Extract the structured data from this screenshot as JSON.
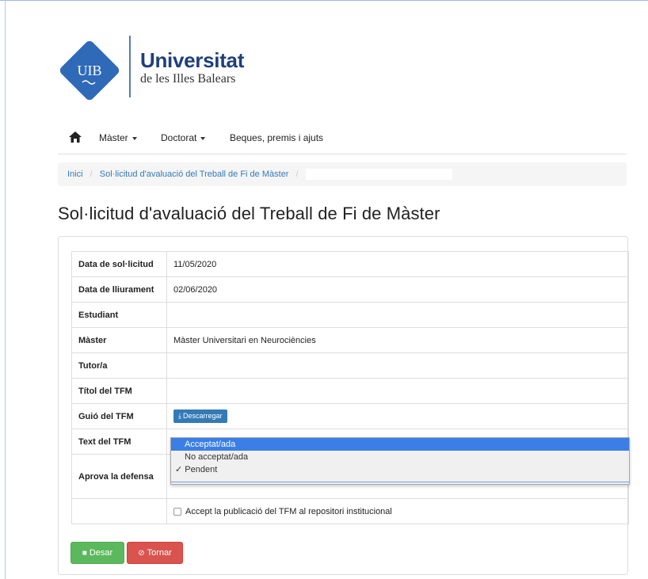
{
  "logo": {
    "mark_text": "UIB",
    "title": "Universitat",
    "subtitle": "de les Illes Balears"
  },
  "nav": {
    "home_icon": "home-icon",
    "items": [
      "Màster",
      "Doctorat",
      "Beques, premis i ajuts"
    ]
  },
  "breadcrumb": {
    "items": [
      "Inici",
      "Sol·licitud d'avaluació del Treball de Fi de Màster"
    ],
    "separator": "/"
  },
  "page_title": "Sol·licitud d'avaluació del Treball de Fi de Màster",
  "form": {
    "rows": [
      {
        "label": "Data de sol·licitud",
        "value": "11/05/2020"
      },
      {
        "label": "Data de lliurament",
        "value": "02/06/2020"
      },
      {
        "label": "Estudiant",
        "value": ""
      },
      {
        "label": "Màster",
        "value": "Màster Universitari en Neurociències"
      },
      {
        "label": "Tutor/a",
        "value": ""
      },
      {
        "label": "Títol del TFM",
        "value": ""
      },
      {
        "label": "Guió del TFM",
        "value": ""
      },
      {
        "label": "Text del TFM",
        "value": ""
      },
      {
        "label": "Aprova la defensa",
        "value": ""
      }
    ],
    "download_label": "Descarregar",
    "dropdown_options": [
      "Acceptat/ada",
      "No acceptat/ada",
      "✓ Pendent"
    ],
    "checkbox_label": "Accept la publicació del TFM al repositori institucional",
    "save_label": "Desar",
    "back_label": "Tornar"
  },
  "colors": {
    "brand": "#1f3f7a",
    "link": "#337ab7",
    "save": "#5cb85c",
    "back": "#d9534f",
    "highlight": "#3b7ee6"
  }
}
